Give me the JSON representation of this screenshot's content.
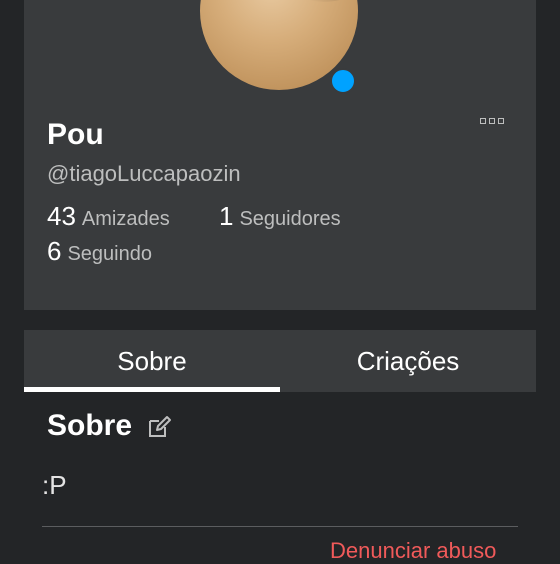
{
  "profile": {
    "display_name": "Pou",
    "username": "@tiagoLuccapaozin",
    "stats": {
      "friends_count": "43",
      "friends_label": "Amizades",
      "followers_count": "1",
      "followers_label": "Seguidores",
      "following_count": "6",
      "following_label": "Seguindo"
    },
    "presence_color": "#00a2ff"
  },
  "tabs": [
    {
      "label": "Sobre",
      "active": true
    },
    {
      "label": "Criações",
      "active": false
    }
  ],
  "about": {
    "title": "Sobre",
    "text": ":P",
    "report_label": "Denunciar abuso"
  },
  "icons": {
    "more": "more-options-icon",
    "edit": "edit-icon"
  },
  "colors": {
    "background": "#232527",
    "card": "#393b3d",
    "report": "#f05a5a"
  }
}
